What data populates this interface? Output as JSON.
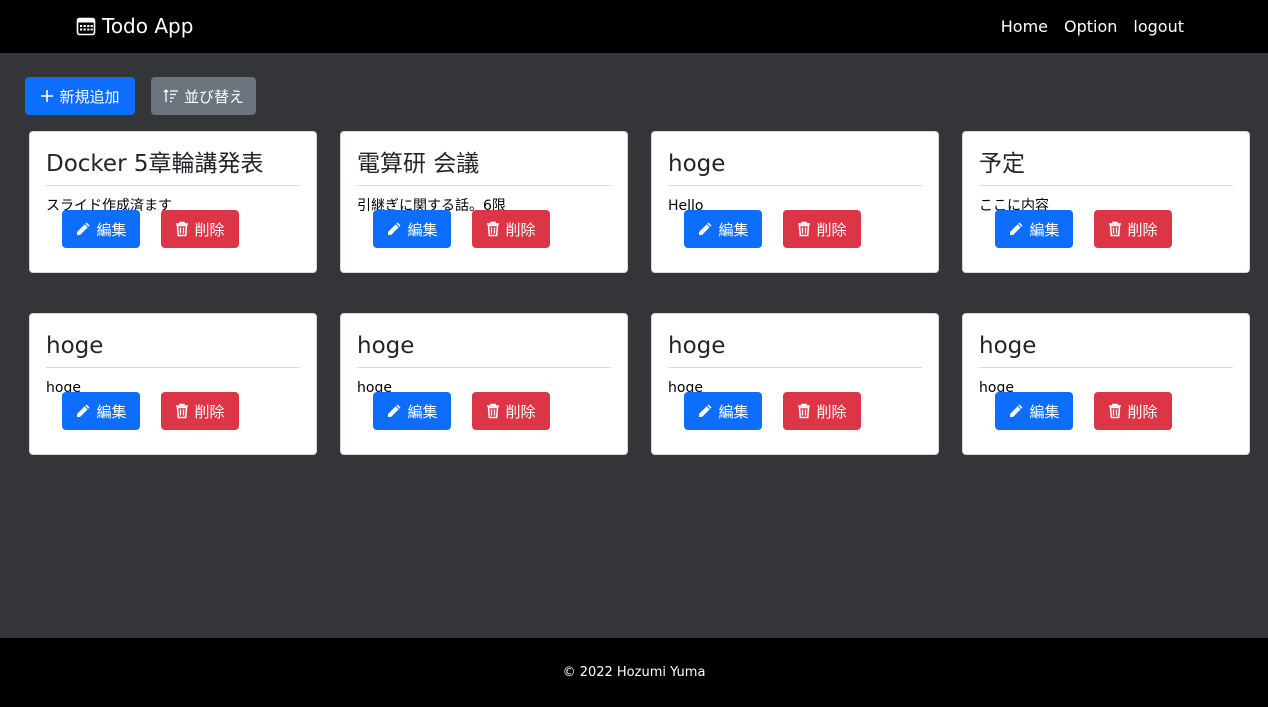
{
  "navbar": {
    "brand": "Todo App",
    "brand_icon": "calendar-icon",
    "links": [
      "Home",
      "Option",
      "logout"
    ]
  },
  "toolbar": {
    "add_label": "新規追加",
    "add_icon": "plus-icon",
    "sort_label": "並び替え",
    "sort_icon": "sort-icon"
  },
  "colors": {
    "primary": "#0d6efd",
    "secondary": "#6c757d",
    "danger": "#dc3545",
    "background": "#343539",
    "navbar": "#000000"
  },
  "card_actions": {
    "edit_label": "編集",
    "edit_icon": "pencil-icon",
    "delete_label": "削除",
    "delete_icon": "trash-icon"
  },
  "todos": [
    {
      "title": "Docker 5章輪講発表",
      "content": "スライド作成済ます"
    },
    {
      "title": "電算研 会議",
      "content": "引継ぎに関する話。6限"
    },
    {
      "title": "hoge",
      "content": "Hello"
    },
    {
      "title": "予定",
      "content": "ここに内容"
    },
    {
      "title": "hoge",
      "content": "hoge"
    },
    {
      "title": "hoge",
      "content": "hoge"
    },
    {
      "title": "hoge",
      "content": "hoge"
    },
    {
      "title": "hoge",
      "content": "hoge"
    }
  ],
  "footer": {
    "copyright": "© 2022 Hozumi Yuma"
  }
}
